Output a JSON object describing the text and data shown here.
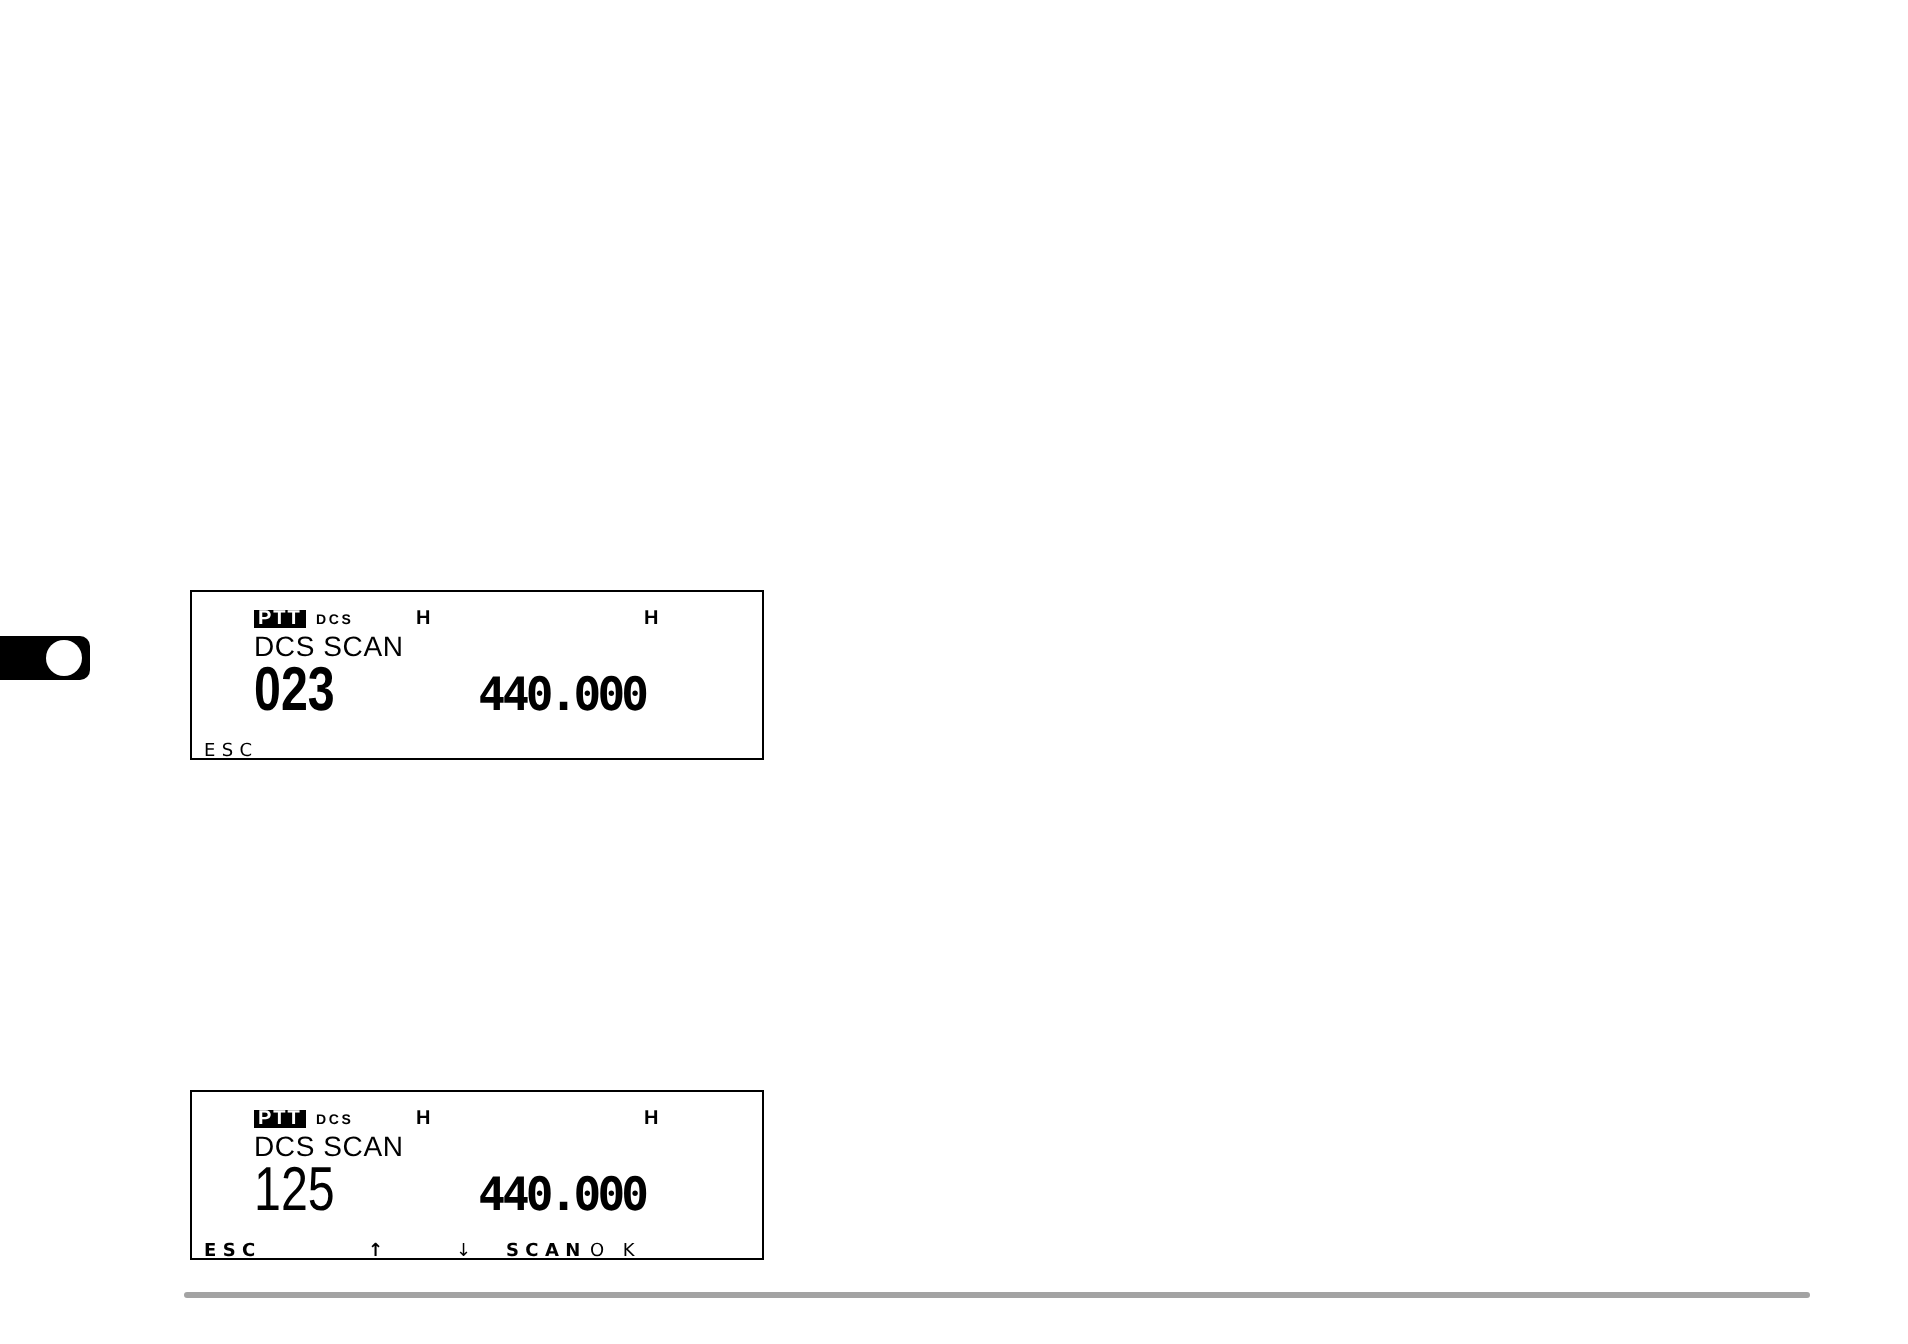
{
  "displays": [
    {
      "indicators": [
        {
          "kind": "inverted",
          "text": "PTT"
        },
        {
          "kind": "small",
          "text": "DCS"
        },
        {
          "kind": "letter",
          "text": "H"
        },
        {
          "kind": "letter",
          "text": "H"
        }
      ],
      "mode": "DCS SCAN",
      "code": "023",
      "code_bold": true,
      "frequency": "440.000",
      "soft_keys": [
        {
          "label": "ESC",
          "bold": false
        }
      ]
    },
    {
      "indicators": [
        {
          "kind": "inverted",
          "text": "PTT"
        },
        {
          "kind": "small",
          "text": "DCS"
        },
        {
          "kind": "letter",
          "text": "H"
        },
        {
          "kind": "letter",
          "text": "H"
        }
      ],
      "mode": "DCS SCAN",
      "code": "125",
      "code_bold": false,
      "frequency": "440.000",
      "soft_keys": [
        {
          "label": "ESC",
          "bold": true
        },
        {
          "label": "↑",
          "bold": true
        },
        {
          "label": "↓",
          "bold": false
        },
        {
          "label": "SCAN",
          "bold": true
        },
        {
          "label": "O K",
          "bold": false
        }
      ]
    }
  ]
}
